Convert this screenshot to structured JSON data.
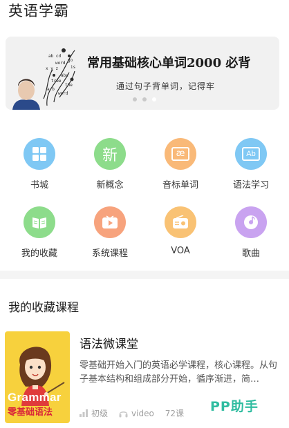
{
  "header": {
    "title": "英语学霸"
  },
  "banner": {
    "title": "常用基础核心单词2000 必背",
    "subtitle": "通过句子背单词，记得牢",
    "dot_count": 3,
    "active_dot": 3
  },
  "menu": {
    "items": [
      {
        "label": "书城",
        "icon": "grid-icon",
        "color": "#7fc8f4"
      },
      {
        "label": "新概念",
        "icon": "xin-char-icon",
        "glyph": "新",
        "color": "#8ddc8b"
      },
      {
        "label": "音标单词",
        "icon": "phonetic-ae-icon",
        "glyph": "æ",
        "color": "#f9b978"
      },
      {
        "label": "语法学习",
        "icon": "ab-icon",
        "glyph": "Ab",
        "color": "#7fc8f4"
      },
      {
        "label": "我的收藏",
        "icon": "book-icon",
        "color": "#8ddc8b"
      },
      {
        "label": "系统课程",
        "icon": "video-play-icon",
        "color": "#f7a37d"
      },
      {
        "label": "VOA",
        "icon": "radio-icon",
        "color": "#f9c274"
      },
      {
        "label": "歌曲",
        "icon": "music-disc-icon",
        "color": "#c9a3f0"
      }
    ]
  },
  "favorites": {
    "section_title": "我的收藏课程",
    "courses": [
      {
        "title": "语法微课堂",
        "description": "零基础开始入门的英语必学课程，核心课程。从句子基本结构和组成部分开始，循序渐进，简…",
        "level": "初级",
        "media": "video",
        "lessons": "72课",
        "thumb_en": "Grammar",
        "thumb_cn": "零基础语法"
      }
    ]
  },
  "watermark": "PP助手"
}
